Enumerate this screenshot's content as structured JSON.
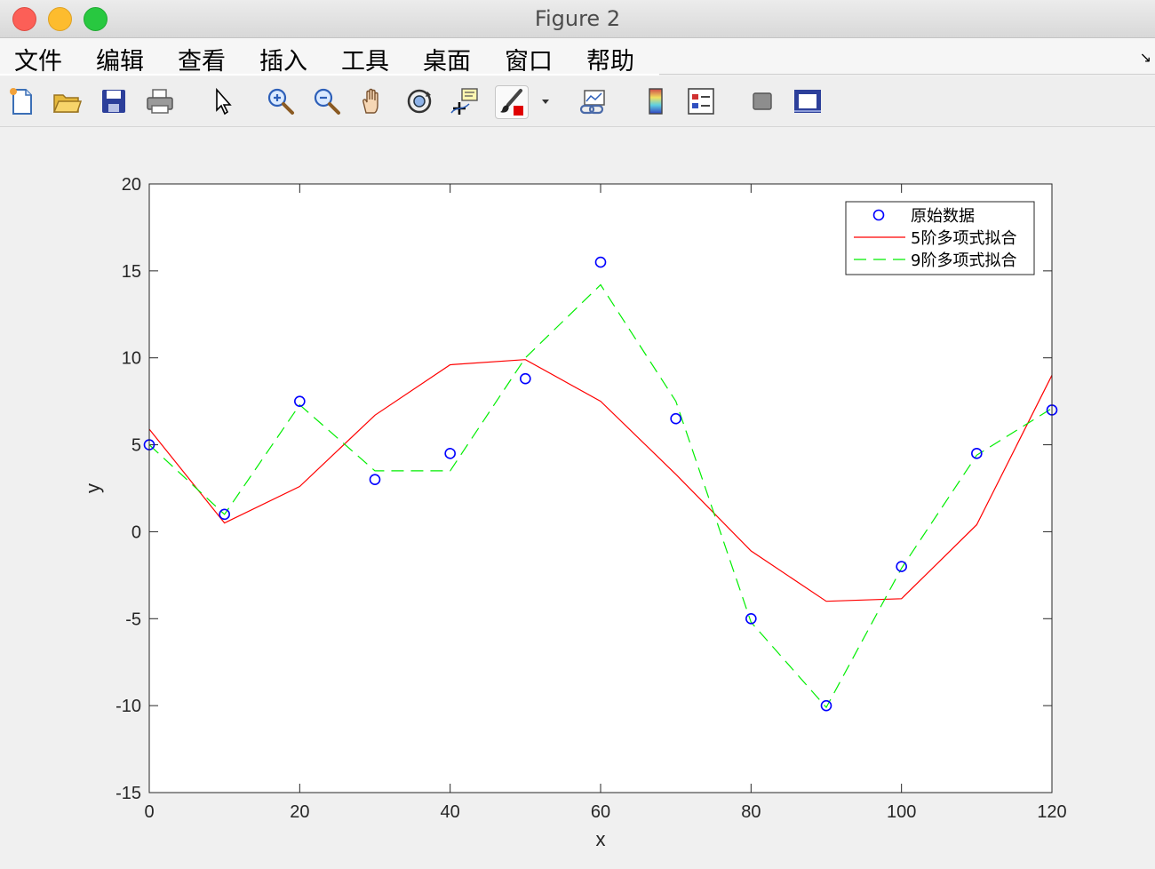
{
  "window": {
    "title": "Figure 2"
  },
  "menu": {
    "items": [
      "文件",
      "编辑",
      "查看",
      "插入",
      "工具",
      "桌面",
      "窗口",
      "帮助"
    ]
  },
  "toolbar": {
    "icons": [
      "new-figure-icon",
      "open-file-icon",
      "save-icon",
      "print-icon",
      "pointer-icon",
      "zoom-in-icon",
      "zoom-out-icon",
      "pan-hand-icon",
      "rotate-3d-icon",
      "data-cursor-icon",
      "brush-icon",
      "dropdown-arrow-icon",
      "link-plot-icon",
      "colorbar-icon",
      "legend-icon",
      "hide-plot-tools-icon",
      "show-plot-tools-icon"
    ]
  },
  "chart_data": {
    "type": "line",
    "title": "",
    "xlabel": "x",
    "ylabel": "y",
    "xlim": [
      0,
      120
    ],
    "ylim": [
      -15,
      20
    ],
    "xticks": [
      0,
      20,
      40,
      60,
      80,
      100,
      120
    ],
    "yticks": [
      -15,
      -10,
      -5,
      0,
      5,
      10,
      15,
      20
    ],
    "grid": false,
    "legend_position": "top-right",
    "x": [
      0,
      10,
      20,
      30,
      40,
      50,
      60,
      70,
      80,
      90,
      100,
      110,
      120
    ],
    "series": [
      {
        "name": "原始数据",
        "style": "markers",
        "color": "#0000ff",
        "values": [
          5,
          1,
          7.5,
          3,
          4.5,
          8.8,
          15.5,
          6.5,
          -5,
          -10,
          -2,
          4.5,
          7
        ]
      },
      {
        "name": "5阶多项式拟合",
        "style": "solid",
        "color": "#ff0000",
        "values": [
          5.9,
          0.5,
          2.6,
          6.7,
          9.6,
          9.9,
          7.5,
          3.3,
          -1.1,
          -4.0,
          -3.85,
          0.4,
          9.0
        ]
      },
      {
        "name": "9阶多项式拟合",
        "style": "dashed",
        "color": "#00ee00",
        "values": [
          5.0,
          1.0,
          7.3,
          3.5,
          3.5,
          10.0,
          14.2,
          7.5,
          -5.2,
          -10.1,
          -2.1,
          4.4,
          7.1
        ]
      }
    ]
  }
}
